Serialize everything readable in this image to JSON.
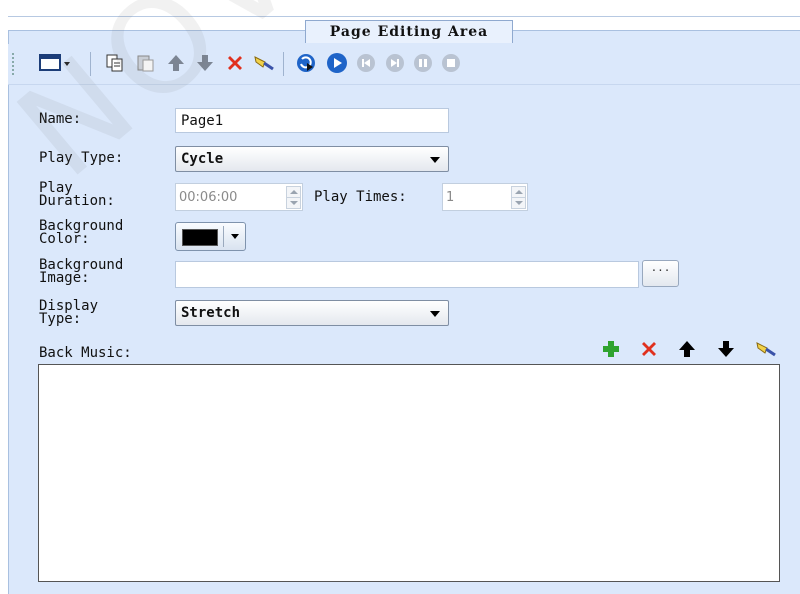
{
  "panel": {
    "title": "Page Editing Area"
  },
  "toolbar": {
    "items": [
      {
        "name": "new-page",
        "icon": "window-dropdown-icon"
      },
      {
        "name": "copy",
        "icon": "copy-icon"
      },
      {
        "name": "paste",
        "icon": "paste-icon"
      },
      {
        "name": "move-up",
        "icon": "arrow-up-icon"
      },
      {
        "name": "move-down",
        "icon": "arrow-down-icon"
      },
      {
        "name": "delete",
        "icon": "red-x-icon"
      },
      {
        "name": "clear",
        "icon": "broom-icon"
      },
      {
        "name": "refresh-play",
        "icon": "play-refresh-icon"
      },
      {
        "name": "play",
        "icon": "play-icon"
      },
      {
        "name": "first",
        "icon": "skip-back-icon"
      },
      {
        "name": "last",
        "icon": "skip-forward-icon"
      },
      {
        "name": "pause",
        "icon": "pause-icon"
      },
      {
        "name": "stop",
        "icon": "stop-icon"
      }
    ]
  },
  "form": {
    "name_label": "Name:",
    "name_value": "Page1",
    "play_type_label": "Play Type:",
    "play_type_value": "Cycle",
    "play_duration_label": "Play\nDuration:",
    "play_duration_value": "00:06:00",
    "play_times_label": "Play Times:",
    "play_times_value": "1",
    "background_color_label": "Background\nColor:",
    "background_color_value": "#000000",
    "background_image_label": "Background\nImage:",
    "background_image_value": "",
    "browse_label": "···",
    "display_type_label": "Display\nType:",
    "display_type_value": "Stretch",
    "back_music_label": "Back Music:"
  },
  "music_toolbar": [
    "add-icon",
    "delete-icon",
    "arrow-up-icon",
    "arrow-down-icon",
    "broom-icon"
  ],
  "watermark": "NOVA",
  "colors": {
    "panel_bg": "#dbe8fb",
    "accent_blue": "#1f64c8",
    "delete_red": "#e0301e",
    "add_green": "#2fa32f"
  }
}
